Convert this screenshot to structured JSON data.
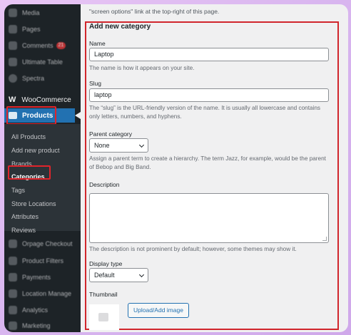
{
  "sidebar": {
    "top_items": [
      {
        "label": "Media",
        "icon": "media-icon"
      },
      {
        "label": "Pages",
        "icon": "pages-icon"
      },
      {
        "label": "Comments",
        "icon": "comments-icon",
        "badge": "21"
      },
      {
        "label": "Ultimate Table",
        "icon": "table-icon"
      },
      {
        "label": "Spectra",
        "icon": "spectra-icon"
      }
    ],
    "woocommerce": {
      "logo": "W",
      "label": "WooCommerce"
    },
    "products": {
      "label": "Products"
    },
    "submenu": [
      "All Products",
      "Add new product",
      "Brands",
      "Categories",
      "Tags",
      "Store Locations",
      "Attributes",
      "Reviews"
    ],
    "bottom_items": [
      {
        "label": "Orpage Checkout",
        "icon": "cart-icon"
      },
      {
        "label": "Product Filters",
        "icon": "filter-icon"
      },
      {
        "label": "Payments",
        "icon": "payments-icon"
      },
      {
        "label": "Location Manage",
        "icon": "location-icon"
      },
      {
        "label": "Analytics",
        "icon": "analytics-icon"
      },
      {
        "label": "Marketing",
        "icon": "marketing-icon"
      }
    ]
  },
  "main": {
    "top_text": "\"screen options\" link at the top-right of this page.",
    "form_title": "Add new category",
    "name": {
      "label": "Name",
      "value": "Laptop",
      "help": "The name is how it appears on your site."
    },
    "slug": {
      "label": "Slug",
      "value": "laptop",
      "help": "The “slug” is the URL-friendly version of the name. It is usually all lowercase and contains only letters, numbers, and hyphens."
    },
    "parent": {
      "label": "Parent category",
      "value": "None",
      "help": "Assign a parent term to create a hierarchy. The term Jazz, for example, would be the parent of Bebop and Big Band."
    },
    "description": {
      "label": "Description",
      "value": "",
      "help": "The description is not prominent by default; however, some themes may show it."
    },
    "display_type": {
      "label": "Display type",
      "value": "Default"
    },
    "thumbnail": {
      "label": "Thumbnail",
      "button": "Upload/Add image"
    }
  },
  "colors": {
    "accent": "#2271b1",
    "highlight": "#e0242b",
    "sidebar": "#1d2327"
  }
}
